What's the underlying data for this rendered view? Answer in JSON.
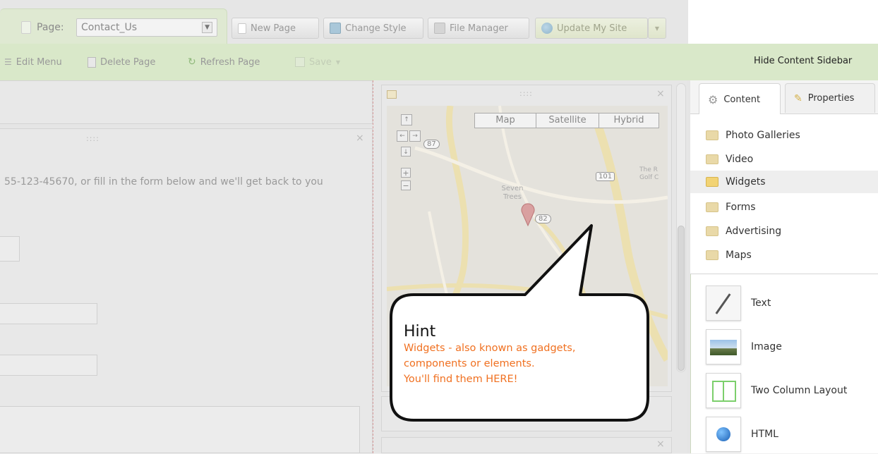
{
  "toolbar": {
    "page_label": "Page:",
    "page_value": "Contact_Us",
    "new_page": "New Page",
    "change_style": "Change Style",
    "file_manager": "File Manager",
    "update_site": "Update My Site"
  },
  "toolbar2": {
    "edit_menu": "Edit Menu",
    "delete_page": "Delete Page",
    "refresh_page": "Refresh Page",
    "save": "Save",
    "hide_sidebar": "Hide Content Sidebar"
  },
  "content": {
    "form_intro": "55-123-45670, or fill in the form below and we'll get back to you"
  },
  "map": {
    "map_btn": "Map",
    "satellite_btn": "Satellite",
    "hybrid_btn": "Hybrid",
    "label_seven_trees": "Seven Trees",
    "route_87": "87",
    "route_101": "101",
    "route_82": "82",
    "golf_label": "The R Golf C"
  },
  "sidebar": {
    "tab_content": "Content",
    "tab_properties": "Properties",
    "categories": [
      "Photo Galleries",
      "Video",
      "Widgets",
      "Forms",
      "Advertising",
      "Maps"
    ],
    "widgets": [
      "Text",
      "Image",
      "Two Column Layout",
      "HTML"
    ]
  },
  "hint": {
    "title": "Hint",
    "line1": "Widgets - also known as gadgets,",
    "line2": "components or elements.",
    "line3": "You'll find them HERE!"
  },
  "colors": {
    "accent_green": "#d9e8c9",
    "hint_orange": "#f07020"
  }
}
